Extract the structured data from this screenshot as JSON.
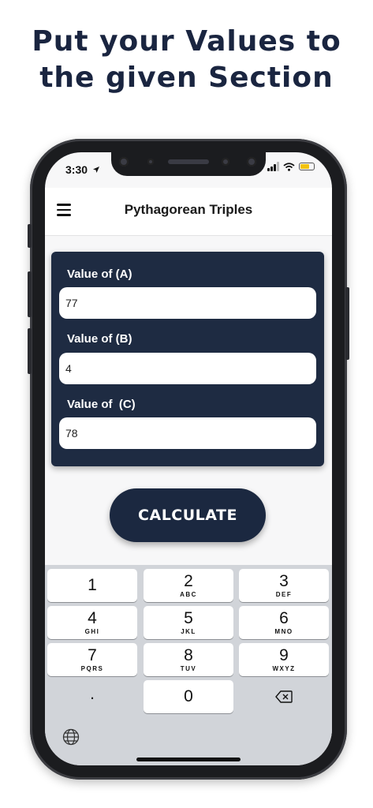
{
  "headline": {
    "line1": "Put your Values to",
    "line2": "the given Section"
  },
  "status_bar": {
    "time": "3:30",
    "battery_level": 0.7,
    "battery_color": "#f3c20e"
  },
  "app_bar": {
    "title": "Pythagorean Triples",
    "menu_icon": "hamburger-menu-icon"
  },
  "form": {
    "card_color": "#1e2b42",
    "fields": [
      {
        "label": "Value of (A)",
        "value": "77",
        "placeholder": ""
      },
      {
        "label": "Value of (B)",
        "value": "4",
        "placeholder": ""
      },
      {
        "label": "Value of  (C)",
        "value": "78",
        "placeholder": ""
      }
    ]
  },
  "calculate_button": {
    "label": "CALCULATE",
    "color": "#1b2840"
  },
  "keyboard": {
    "keys": [
      {
        "digit": "1",
        "letters": ""
      },
      {
        "digit": "2",
        "letters": "ABC"
      },
      {
        "digit": "3",
        "letters": "DEF"
      },
      {
        "digit": "4",
        "letters": "GHI"
      },
      {
        "digit": "5",
        "letters": "JKL"
      },
      {
        "digit": "6",
        "letters": "MNO"
      },
      {
        "digit": "7",
        "letters": "PQRS"
      },
      {
        "digit": "8",
        "letters": "TUV"
      },
      {
        "digit": "9",
        "letters": "WXYZ"
      }
    ],
    "decimal": ".",
    "zero": "0",
    "delete_icon": "backspace-icon",
    "globe_icon": "globe-icon"
  }
}
